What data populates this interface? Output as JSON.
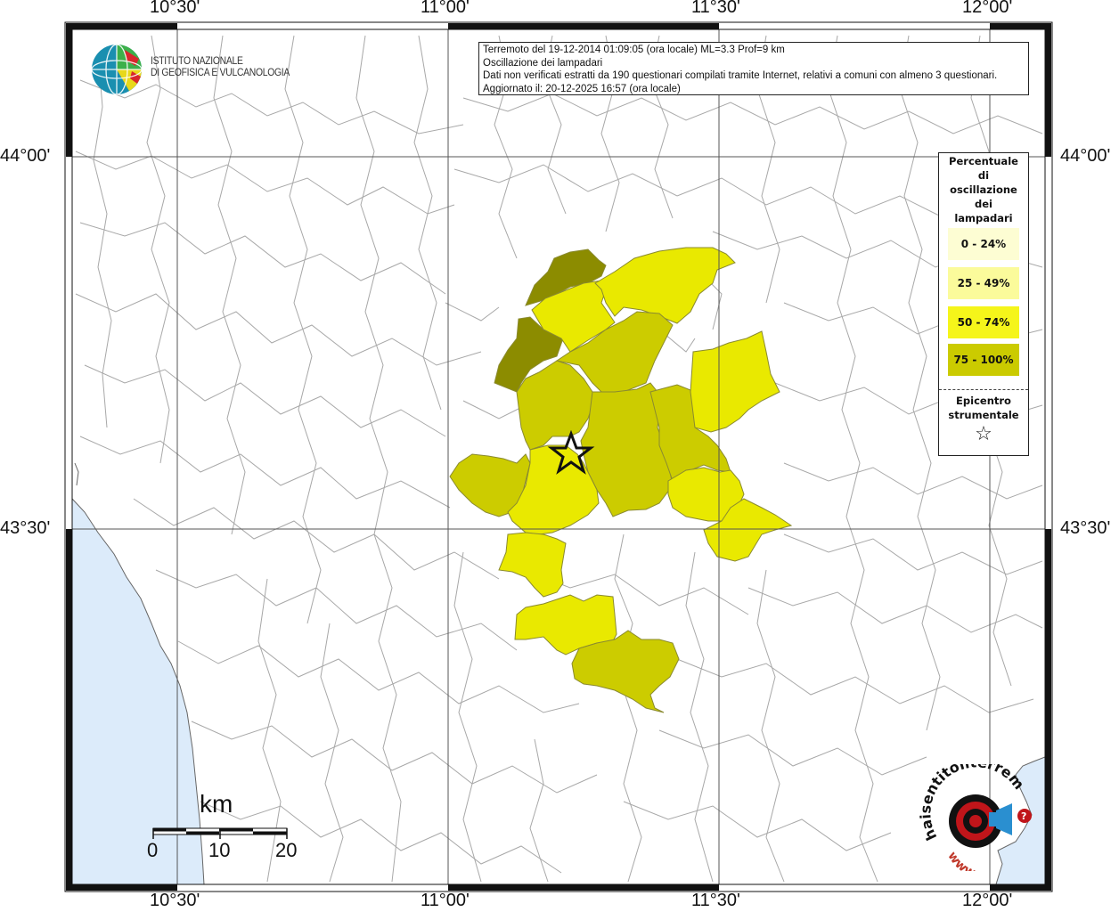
{
  "header": {
    "line1": "Terremoto del 19-12-2014 01:09:05 (ora locale) ML=3.3 Prof=9 km",
    "line2": "Oscillazione dei lampadari",
    "line3": "Dati non verificati estratti da 190 questionari compilati tramite Internet, relativi a comuni con almeno 3 questionari.",
    "line4": "Aggiornato il: 20-12-2025 16:57 (ora locale)"
  },
  "institute": {
    "line1": "ISTITUTO NAZIONALE",
    "line2": "DI GEOFISICA E VULCANOLOGIA"
  },
  "axes": {
    "lon_ticks": [
      "10°30'",
      "11°00'",
      "11°30'",
      "12°00'"
    ],
    "lat_ticks": [
      "44°00'",
      "43°30'"
    ]
  },
  "legend": {
    "title_lines": [
      "Percentuale",
      "di",
      "oscillazione",
      "dei",
      "lampadari"
    ],
    "classes": [
      {
        "label": "0 - 24%",
        "color": "#fdfdd3"
      },
      {
        "label": "25 - 49%",
        "color": "#fbfb9b"
      },
      {
        "label": "50 - 74%",
        "color": "#f5f51a"
      },
      {
        "label": "75 - 100%",
        "color": "#cbcb00"
      }
    ],
    "epicenter_lines": [
      "Epicentro",
      "strumentale"
    ],
    "epicenter_symbol": "☆"
  },
  "scale": {
    "title": "km",
    "labels": [
      "0",
      "10",
      "20"
    ]
  },
  "colors": {
    "sea": "#dcebfa",
    "border_line": "#a8a8a8",
    "grid": "#555555",
    "class_25_49": "#f2f25a",
    "class_50_74": "#e9e900",
    "class_75_100_light": "#cccc00",
    "class_75_100_dark": "#8c8c00",
    "class_high_mid": "#b4b400"
  },
  "epicenter": {
    "label_symbol": "star-icon"
  },
  "watermark": {
    "text": "haisentitoilterremoto.it",
    "url_text": "www."
  }
}
